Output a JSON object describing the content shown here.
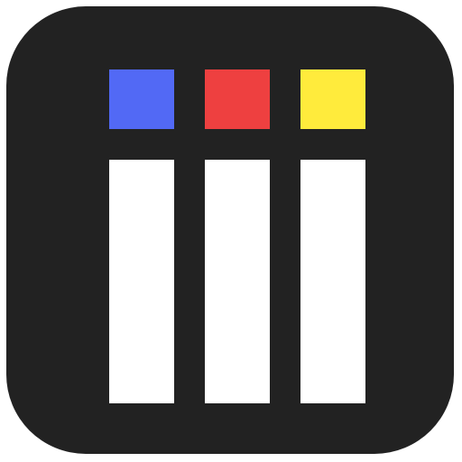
{
  "icon": {
    "name": "color-columns-app-icon",
    "background_color": "#222222",
    "swatches": [
      {
        "name": "blue-swatch",
        "color": "#5269F5"
      },
      {
        "name": "red-swatch",
        "color": "#EE4040"
      },
      {
        "name": "yellow-swatch",
        "color": "#FFEB3C"
      }
    ],
    "bar_color": "#FFFFFF"
  }
}
